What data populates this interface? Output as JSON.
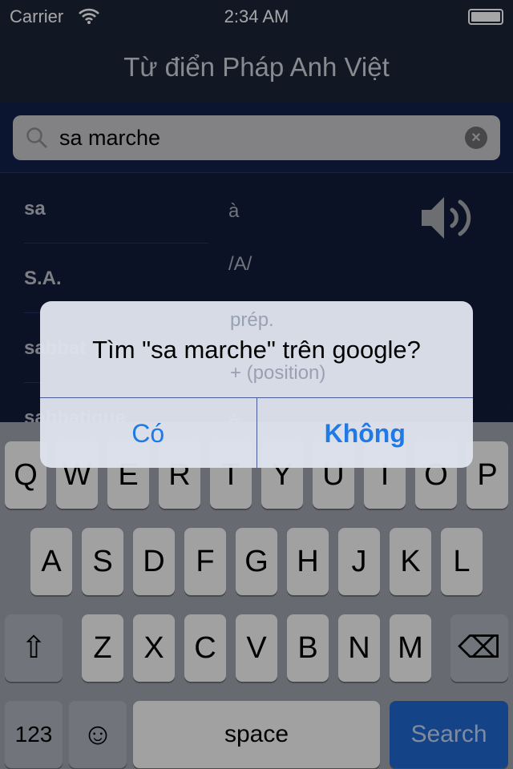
{
  "status": {
    "carrier": "Carrier",
    "time": "2:34 AM",
    "battery_level": 1.0
  },
  "nav": {
    "title": "Từ điển Pháp Anh Việt"
  },
  "search": {
    "value": "sa marche",
    "clear_icon": "clear-circle-icon"
  },
  "list": {
    "items": [
      "sa",
      "S.A.",
      "sabbat",
      "sabbatique"
    ]
  },
  "detail": {
    "lines": [
      "à",
      "/A/",
      "prép.",
      "+ (position)",
      "ở"
    ]
  },
  "keyboard": {
    "row1": [
      "Q",
      "W",
      "E",
      "R",
      "T",
      "Y",
      "U",
      "I",
      "O",
      "P"
    ],
    "row2": [
      "A",
      "S",
      "D",
      "F",
      "G",
      "H",
      "J",
      "K",
      "L"
    ],
    "row3": [
      "Z",
      "X",
      "C",
      "V",
      "B",
      "N",
      "M"
    ],
    "numbers": "123",
    "emoji": "☺",
    "space": "space",
    "search": "Search",
    "shift": "⇧",
    "delete": "⌫"
  },
  "alert": {
    "message": "Tìm \"sa marche\" trên google?",
    "yes": "Có",
    "no": "Không"
  },
  "colors": {
    "accent": "#1f7ae6",
    "nav": "#1b2638",
    "background": "#131d3a"
  }
}
